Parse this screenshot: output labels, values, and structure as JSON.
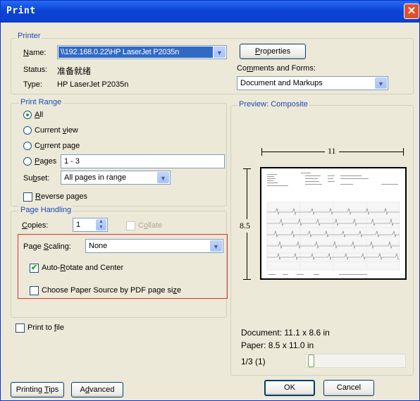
{
  "window": {
    "title": "Print",
    "close_icon": "close-icon"
  },
  "printer": {
    "section_label": "Printer",
    "name_label": "Name:",
    "name_value": "\\\\192.168.0.22\\HP LaserJet P2035n",
    "status_label": "Status:",
    "status_value": "准备就绪",
    "type_label": "Type:",
    "type_value": "HP LaserJet P2035n",
    "properties_button": "Properties",
    "comments_label": "Comments and Forms:",
    "comments_value": "Document and Markups"
  },
  "print_range": {
    "section_label": "Print Range",
    "options": [
      "All",
      "Current view",
      "Current page",
      "Pages"
    ],
    "selected": "All",
    "pages_value": "1 - 3",
    "subset_label": "Subset:",
    "subset_value": "All pages in range",
    "reverse_label": "Reverse pages"
  },
  "page_handling": {
    "section_label": "Page Handling",
    "copies_label": "Copies:",
    "copies_value": "1",
    "collate_label": "Collate",
    "scaling_label": "Page Scaling:",
    "scaling_value": "None",
    "auto_rotate_label": "Auto-Rotate and Center",
    "auto_rotate_checked": true,
    "paper_source_label": "Choose Paper Source by PDF page size",
    "paper_source_checked": false
  },
  "print_to_file": {
    "label": "Print to file",
    "checked": false
  },
  "preview": {
    "section_label": "Preview: Composite",
    "width_label": "11",
    "height_label": "8.5",
    "document_label": "Document: 11.1 x 8.6 in",
    "paper_label": "Paper: 8.5 x 11.0 in",
    "page_counter": "1/3 (1)"
  },
  "buttons": {
    "tips": "Printing Tips",
    "advanced": "Advanced",
    "ok": "OK",
    "cancel": "Cancel"
  },
  "colors": {
    "titlebar": "#0a45d8",
    "section": "#1d4ab8",
    "highlight_box": "#e03030",
    "selection": "#316ac5"
  }
}
